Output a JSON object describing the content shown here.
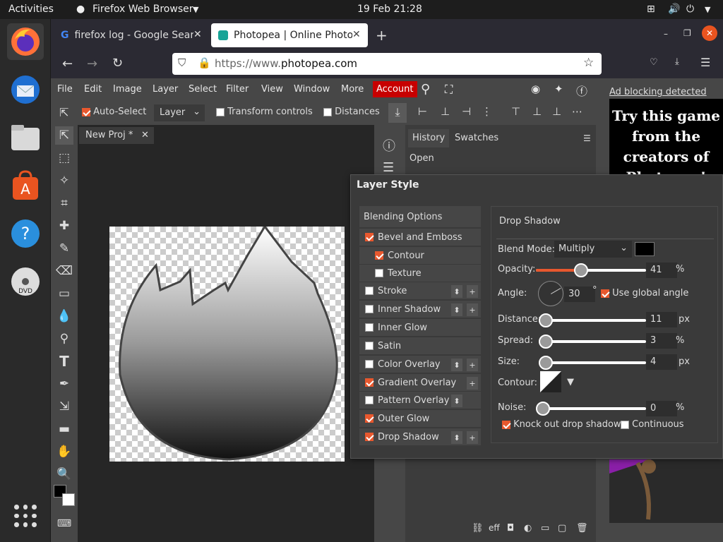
{
  "topbar": {
    "activities": "Activities",
    "app": "Firefox Web Browser",
    "clock": "19 Feb  21:28"
  },
  "tabs": [
    {
      "label": "firefox log - Google Search"
    },
    {
      "label": "Photopea | Online Photo Editor"
    }
  ],
  "url": {
    "prefix": "https://www.",
    "domain": "photopea.com"
  },
  "menu": [
    "File",
    "Edit",
    "Image",
    "Layer",
    "Select",
    "Filter",
    "View",
    "Window",
    "More"
  ],
  "account": "Account",
  "options": {
    "auto_select": "Auto-Select",
    "layer_dropdown": "Layer",
    "transform": "Transform controls",
    "distances": "Distances"
  },
  "document_tab": "New Proj *",
  "panel": {
    "tab1": "History",
    "tab2": "Swatches",
    "history_item": "Open"
  },
  "ad": {
    "blocking": "Ad blocking detected",
    "text": "Try this game from the creators of Photopea!"
  },
  "dialog": {
    "title": "Layer Style",
    "blending": "Blending Options",
    "styles": [
      {
        "label": "Bevel and Emboss",
        "checked": true
      },
      {
        "label": "Contour",
        "checked": true
      },
      {
        "label": "Texture",
        "checked": false
      },
      {
        "label": "Stroke",
        "checked": false
      },
      {
        "label": "Inner Shadow",
        "checked": false
      },
      {
        "label": "Inner Glow",
        "checked": false
      },
      {
        "label": "Satin",
        "checked": false
      },
      {
        "label": "Color Overlay",
        "checked": false
      },
      {
        "label": "Gradient Overlay",
        "checked": true
      },
      {
        "label": "Pattern Overlay",
        "checked": false
      },
      {
        "label": "Outer Glow",
        "checked": true
      },
      {
        "label": "Drop Shadow",
        "checked": true
      }
    ],
    "section": "Drop Shadow",
    "blend_mode_label": "Blend Mode:",
    "blend_mode": "Multiply",
    "shadow_color": "#000000",
    "opacity_label": "Opacity:",
    "opacity": "41",
    "opacity_unit": "%",
    "angle_label": "Angle:",
    "angle": "30",
    "angle_unit": "°",
    "global_angle": "Use global angle",
    "distance_label": "Distance:",
    "distance": "11",
    "distance_unit": "px",
    "spread_label": "Spread:",
    "spread": "3",
    "spread_unit": "%",
    "size_label": "Size:",
    "size": "4",
    "size_unit": "px",
    "contour_label": "Contour:",
    "noise_label": "Noise:",
    "noise": "0",
    "noise_unit": "%",
    "knockout": "Knock out drop shadow",
    "continuous": "Continuous"
  }
}
